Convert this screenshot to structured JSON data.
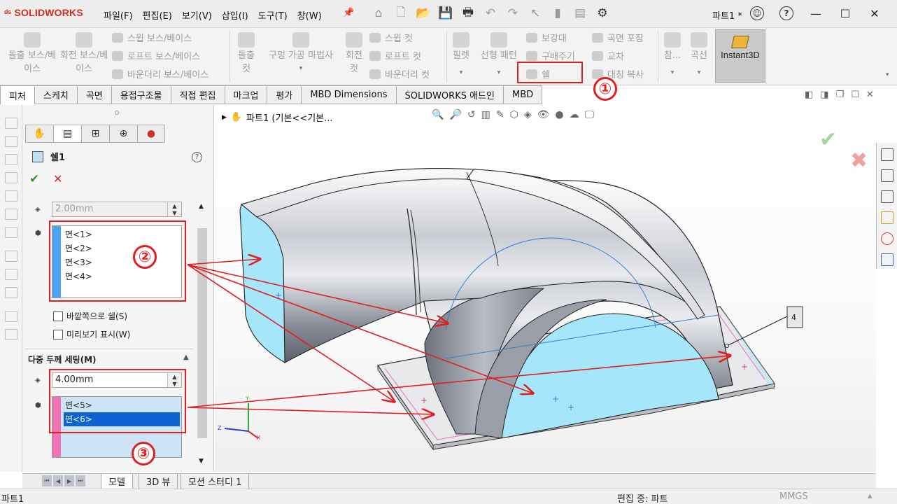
{
  "app": {
    "brand": "SOLIDWORKS",
    "document_title": "파트1 *"
  },
  "menu": [
    "파일(F)",
    "편집(E)",
    "보기(V)",
    "삽입(I)",
    "도구(T)",
    "창(W)"
  ],
  "command_manager": {
    "extrude_boss": "돌출 보스/베이스",
    "revolve_boss": "회전 보스/베이스",
    "sweep_boss": "스윕 보스/베이스",
    "loft_boss": "로프트 보스/베이스",
    "boundary_boss": "바운더리 보스/베이스",
    "extrude_cut": "돌출 컷",
    "hole_wizard": "구멍 가공 마법사",
    "revolve_cut": "회전 컷",
    "sweep_cut": "스윕 컷",
    "loft_cut": "로프트 컷",
    "boundary_cut": "바운더리 컷",
    "fillet": "필렛",
    "linear_pattern": "선형 패턴",
    "rib": "보강대",
    "draft": "구배주기",
    "shell": "쉘",
    "wrap": "곡면 포장",
    "intersect": "교차",
    "mirror": "대칭 복사",
    "reference": "참...",
    "curves": "곡선",
    "instant3d": "Instant3D"
  },
  "tabs": [
    "피처",
    "스케치",
    "곡면",
    "용접구조물",
    "직접 편집",
    "마크업",
    "평가",
    "MBD Dimensions",
    "SOLIDWORKS 애드인",
    "MBD"
  ],
  "property_manager": {
    "title": "쉘1",
    "help": "?",
    "ok": "✔",
    "cancel": "✕",
    "thickness": "2.00mm",
    "faces_to_remove": [
      "면<1>",
      "면<2>",
      "면<3>",
      "면<4>"
    ],
    "shell_outward": "바깥쪽으로 쉘(S)",
    "show_preview": "미리보기 표시(W)",
    "multi_thickness_header": "다중 두께 세팅(M)",
    "multi_thickness": "4.00mm",
    "multi_faces": [
      "면<5>",
      "면<6>"
    ],
    "multi_selected_index": 1
  },
  "graphics": {
    "tree_root": "파트1  (기본<<기본...",
    "callout_value": "4"
  },
  "annotations": {
    "one": "①",
    "two": "②",
    "three": "③"
  },
  "bottom_tabs": [
    "모델",
    "3D 뷰",
    "모션 스터디 1"
  ],
  "status": {
    "left": "파트1",
    "mode": "편집 중: 파트",
    "units": "MMGS"
  },
  "colors": {
    "accent_red": "#e02020",
    "selection_blue": "#4ea3f5",
    "selection_pink": "#f073b4",
    "face_cyan": "#a6e6fb",
    "brand_red": "#d52b1e"
  }
}
